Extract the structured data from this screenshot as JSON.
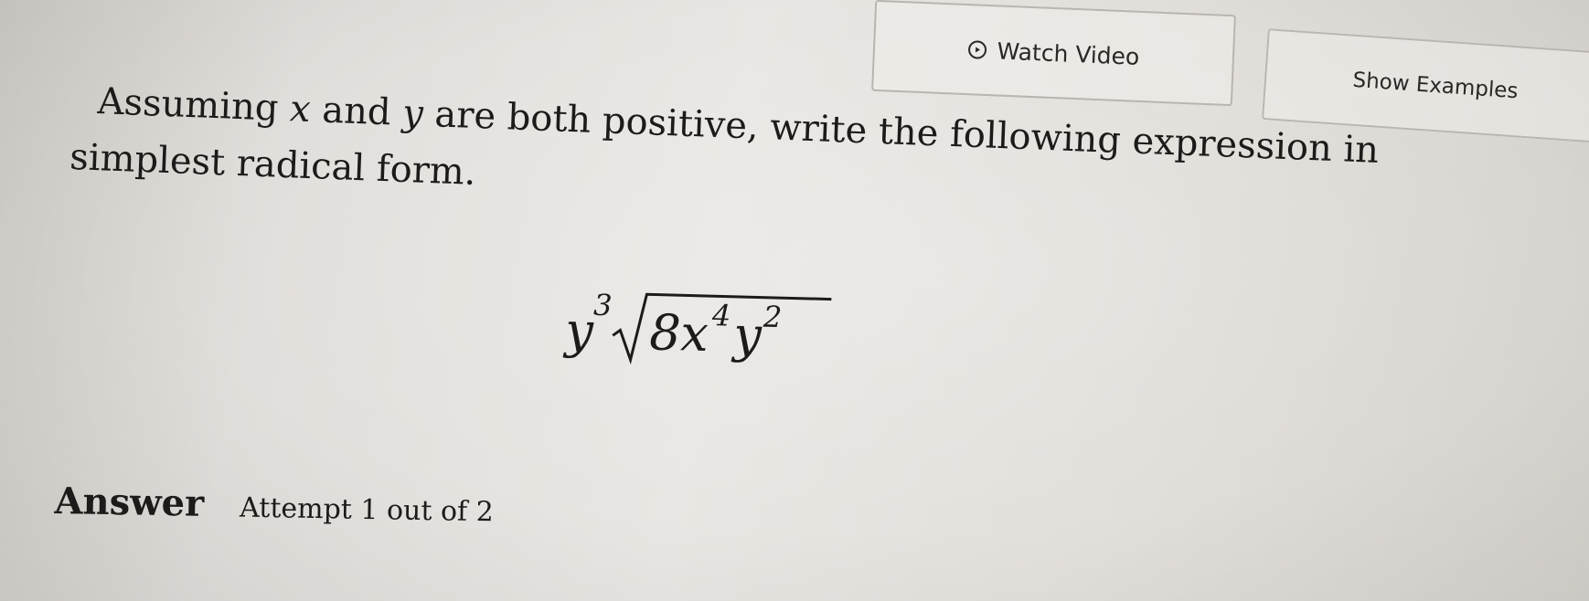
{
  "toolbar": {
    "watch_video_label": "Watch Video",
    "show_examples_label": "Show Examples"
  },
  "question": {
    "line1_part1": "Assuming ",
    "var_x": "x",
    "line1_part2": " and ",
    "var_y": "y",
    "line1_part3": " are both positive, write the following expression in",
    "line2": "simplest radical form."
  },
  "expression": {
    "coefficient_base": "y",
    "coefficient_exponent": "3",
    "radicand_number": "8",
    "radicand_var1": "x",
    "radicand_exp1": "4",
    "radicand_var2": "y",
    "radicand_exp2": "2"
  },
  "answer": {
    "label": "Answer",
    "attempt": "Attempt 1 out of 2"
  },
  "icons": {
    "video": "play-circle-icon"
  }
}
